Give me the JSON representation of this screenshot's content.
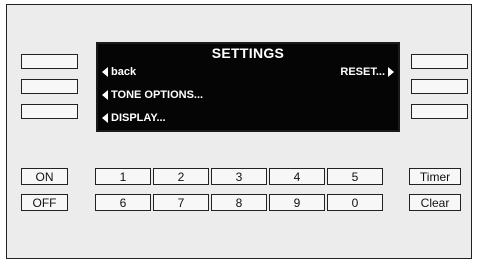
{
  "screen": {
    "title": "SETTINGS",
    "menu": {
      "back": "back",
      "reset": "RESET...",
      "tone_options": "TONE OPTIONS...",
      "display": "DISPLAY..."
    }
  },
  "keys": {
    "on": "ON",
    "off": "OFF",
    "timer": "Timer",
    "clear": "Clear",
    "digits_row1": [
      "1",
      "2",
      "3",
      "4",
      "5"
    ],
    "digits_row2": [
      "6",
      "7",
      "8",
      "9",
      "0"
    ]
  }
}
